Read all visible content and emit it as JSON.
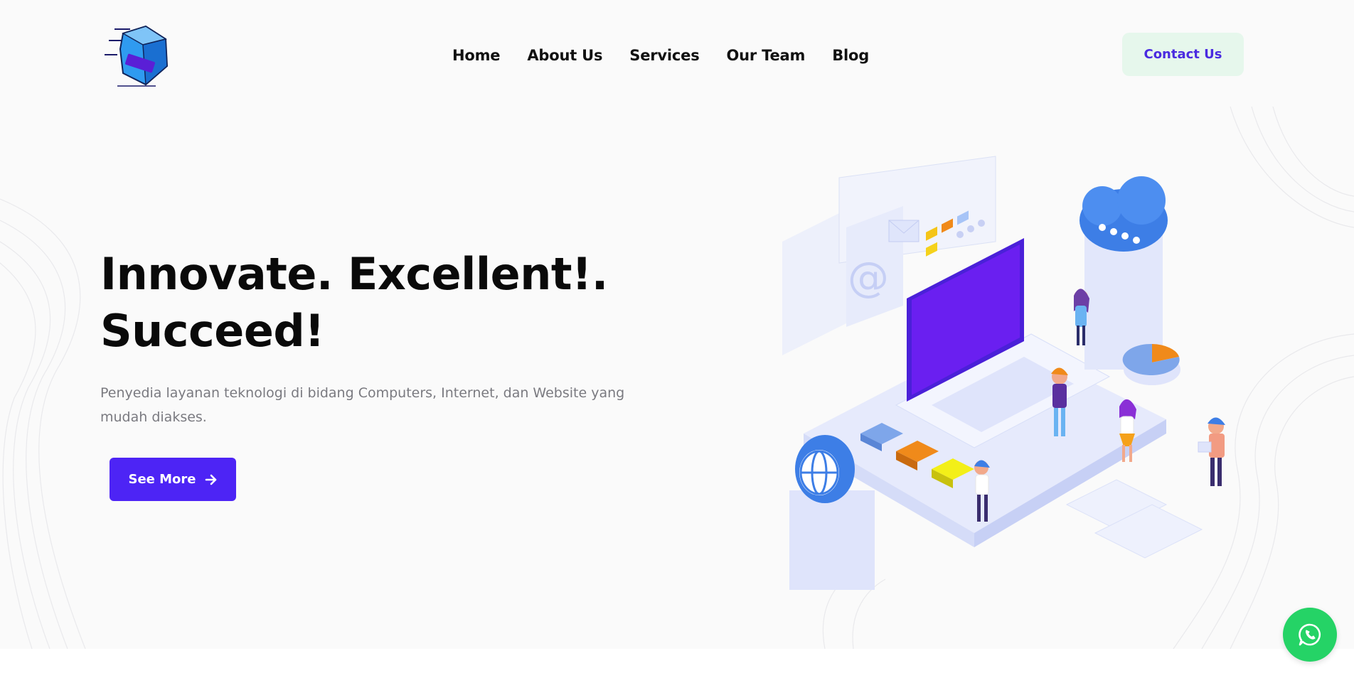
{
  "header": {
    "logo_icon": "cube-logo-icon",
    "nav": [
      "Home",
      "About Us",
      "Services",
      "Our Team",
      "Blog"
    ],
    "contact_label": "Contact Us"
  },
  "hero": {
    "headline_line1": "Innovate. Excellent!.",
    "headline_line2": "Succeed!",
    "subtitle": "Penyedia layanan teknologi di bidang Computers, Internet, dan Website yang mudah diakses.",
    "cta_label": "See More",
    "cta_icon": "arrow-right-icon",
    "illustration": "isometric-tech-workspace-illustration"
  },
  "floating": {
    "whatsapp_icon": "whatsapp-icon"
  },
  "colors": {
    "primary": "#4d24f5",
    "contact_bg": "#e6f7ec",
    "whatsapp": "#25d366",
    "hero_bg": "#fafafa"
  }
}
